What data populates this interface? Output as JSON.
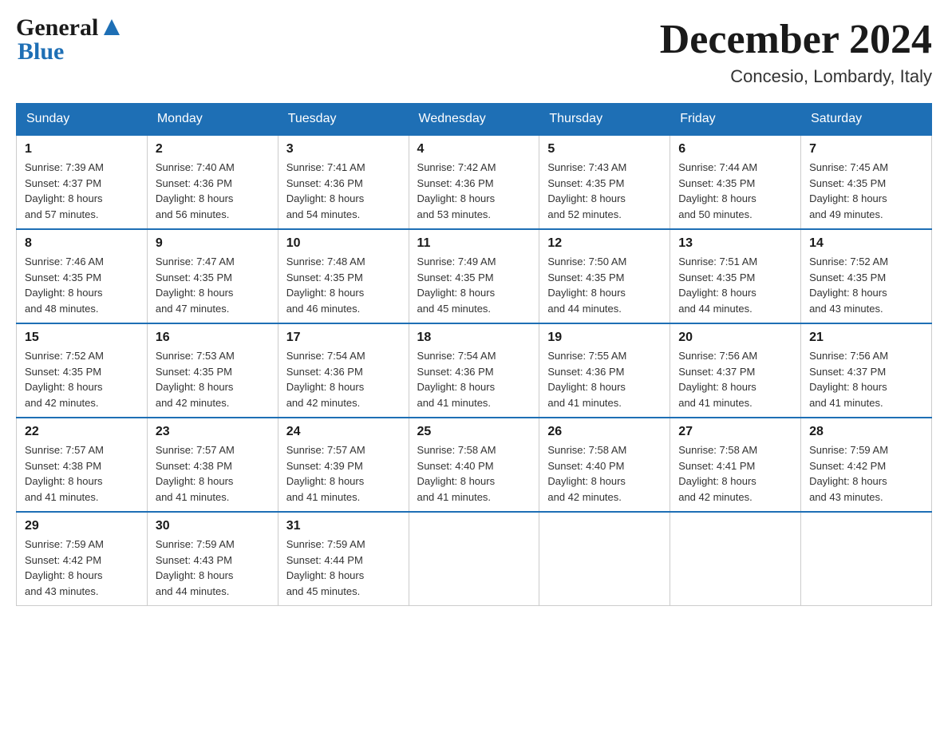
{
  "header": {
    "title": "December 2024",
    "location": "Concesio, Lombardy, Italy"
  },
  "days_of_week": [
    "Sunday",
    "Monday",
    "Tuesday",
    "Wednesday",
    "Thursday",
    "Friday",
    "Saturday"
  ],
  "weeks": [
    [
      {
        "day": "1",
        "sunrise": "7:39 AM",
        "sunset": "4:37 PM",
        "daylight": "8 hours and 57 minutes."
      },
      {
        "day": "2",
        "sunrise": "7:40 AM",
        "sunset": "4:36 PM",
        "daylight": "8 hours and 56 minutes."
      },
      {
        "day": "3",
        "sunrise": "7:41 AM",
        "sunset": "4:36 PM",
        "daylight": "8 hours and 54 minutes."
      },
      {
        "day": "4",
        "sunrise": "7:42 AM",
        "sunset": "4:36 PM",
        "daylight": "8 hours and 53 minutes."
      },
      {
        "day": "5",
        "sunrise": "7:43 AM",
        "sunset": "4:35 PM",
        "daylight": "8 hours and 52 minutes."
      },
      {
        "day": "6",
        "sunrise": "7:44 AM",
        "sunset": "4:35 PM",
        "daylight": "8 hours and 50 minutes."
      },
      {
        "day": "7",
        "sunrise": "7:45 AM",
        "sunset": "4:35 PM",
        "daylight": "8 hours and 49 minutes."
      }
    ],
    [
      {
        "day": "8",
        "sunrise": "7:46 AM",
        "sunset": "4:35 PM",
        "daylight": "8 hours and 48 minutes."
      },
      {
        "day": "9",
        "sunrise": "7:47 AM",
        "sunset": "4:35 PM",
        "daylight": "8 hours and 47 minutes."
      },
      {
        "day": "10",
        "sunrise": "7:48 AM",
        "sunset": "4:35 PM",
        "daylight": "8 hours and 46 minutes."
      },
      {
        "day": "11",
        "sunrise": "7:49 AM",
        "sunset": "4:35 PM",
        "daylight": "8 hours and 45 minutes."
      },
      {
        "day": "12",
        "sunrise": "7:50 AM",
        "sunset": "4:35 PM",
        "daylight": "8 hours and 44 minutes."
      },
      {
        "day": "13",
        "sunrise": "7:51 AM",
        "sunset": "4:35 PM",
        "daylight": "8 hours and 44 minutes."
      },
      {
        "day": "14",
        "sunrise": "7:52 AM",
        "sunset": "4:35 PM",
        "daylight": "8 hours and 43 minutes."
      }
    ],
    [
      {
        "day": "15",
        "sunrise": "7:52 AM",
        "sunset": "4:35 PM",
        "daylight": "8 hours and 42 minutes."
      },
      {
        "day": "16",
        "sunrise": "7:53 AM",
        "sunset": "4:35 PM",
        "daylight": "8 hours and 42 minutes."
      },
      {
        "day": "17",
        "sunrise": "7:54 AM",
        "sunset": "4:36 PM",
        "daylight": "8 hours and 42 minutes."
      },
      {
        "day": "18",
        "sunrise": "7:54 AM",
        "sunset": "4:36 PM",
        "daylight": "8 hours and 41 minutes."
      },
      {
        "day": "19",
        "sunrise": "7:55 AM",
        "sunset": "4:36 PM",
        "daylight": "8 hours and 41 minutes."
      },
      {
        "day": "20",
        "sunrise": "7:56 AM",
        "sunset": "4:37 PM",
        "daylight": "8 hours and 41 minutes."
      },
      {
        "day": "21",
        "sunrise": "7:56 AM",
        "sunset": "4:37 PM",
        "daylight": "8 hours and 41 minutes."
      }
    ],
    [
      {
        "day": "22",
        "sunrise": "7:57 AM",
        "sunset": "4:38 PM",
        "daylight": "8 hours and 41 minutes."
      },
      {
        "day": "23",
        "sunrise": "7:57 AM",
        "sunset": "4:38 PM",
        "daylight": "8 hours and 41 minutes."
      },
      {
        "day": "24",
        "sunrise": "7:57 AM",
        "sunset": "4:39 PM",
        "daylight": "8 hours and 41 minutes."
      },
      {
        "day": "25",
        "sunrise": "7:58 AM",
        "sunset": "4:40 PM",
        "daylight": "8 hours and 41 minutes."
      },
      {
        "day": "26",
        "sunrise": "7:58 AM",
        "sunset": "4:40 PM",
        "daylight": "8 hours and 42 minutes."
      },
      {
        "day": "27",
        "sunrise": "7:58 AM",
        "sunset": "4:41 PM",
        "daylight": "8 hours and 42 minutes."
      },
      {
        "day": "28",
        "sunrise": "7:59 AM",
        "sunset": "4:42 PM",
        "daylight": "8 hours and 43 minutes."
      }
    ],
    [
      {
        "day": "29",
        "sunrise": "7:59 AM",
        "sunset": "4:42 PM",
        "daylight": "8 hours and 43 minutes."
      },
      {
        "day": "30",
        "sunrise": "7:59 AM",
        "sunset": "4:43 PM",
        "daylight": "8 hours and 44 minutes."
      },
      {
        "day": "31",
        "sunrise": "7:59 AM",
        "sunset": "4:44 PM",
        "daylight": "8 hours and 45 minutes."
      },
      null,
      null,
      null,
      null
    ]
  ],
  "labels": {
    "sunrise": "Sunrise:",
    "sunset": "Sunset:",
    "daylight": "Daylight:"
  }
}
